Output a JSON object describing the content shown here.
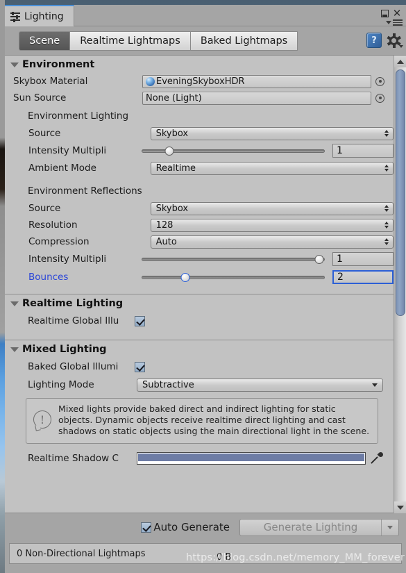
{
  "window": {
    "tab_title": "Lighting",
    "tab_icon": "sliders-icon",
    "minimize_label": "",
    "close_label": "✕",
    "panel_menu_icon": "panel-menu-icon"
  },
  "toolbar": {
    "tabs": [
      {
        "label": "Scene",
        "active": true
      },
      {
        "label": "Realtime Lightmaps",
        "active": false
      },
      {
        "label": "Baked Lightmaps",
        "active": false
      }
    ],
    "help_icon": "?",
    "gear_icon": "gear-icon"
  },
  "sections": {
    "environment": {
      "title": "Environment",
      "skybox_material": {
        "label": "Skybox Material",
        "value": "EveningSkyboxHDR",
        "icon": "material-sphere-icon"
      },
      "sun_source": {
        "label": "Sun Source",
        "value": "None (Light)"
      },
      "environment_lighting": {
        "title": "Environment Lighting",
        "source": {
          "label": "Source",
          "value": "Skybox"
        },
        "intensity_multiplier": {
          "label": "Intensity Multipli",
          "value": "1",
          "slider_pct": 15
        },
        "ambient_mode": {
          "label": "Ambient Mode",
          "value": "Realtime"
        }
      },
      "environment_reflections": {
        "title": "Environment Reflections",
        "source": {
          "label": "Source",
          "value": "Skybox"
        },
        "resolution": {
          "label": "Resolution",
          "value": "128"
        },
        "compression": {
          "label": "Compression",
          "value": "Auto"
        },
        "intensity_multiplier": {
          "label": "Intensity Multipli",
          "value": "1",
          "slider_pct": 97
        },
        "bounces": {
          "label": "Bounces",
          "value": "2",
          "slider_pct": 24,
          "focused": true
        }
      }
    },
    "realtime_lighting": {
      "title": "Realtime Lighting",
      "realtime_gi": {
        "label": "Realtime Global Illu",
        "checked": true
      }
    },
    "mixed_lighting": {
      "title": "Mixed Lighting",
      "baked_gi": {
        "label": "Baked Global Illumi",
        "checked": true
      },
      "lighting_mode": {
        "label": "Lighting Mode",
        "value": "Subtractive"
      },
      "info": "Mixed lights provide baked direct and indirect lighting for static objects. Dynamic objects receive realtime direct lighting and cast shadows on static objects using the main directional light in the scene.",
      "realtime_shadow_color": {
        "label": "Realtime Shadow C",
        "color": "#6d7ca5"
      }
    }
  },
  "footer": {
    "auto_generate": {
      "label": "Auto Generate",
      "checked": true
    },
    "generate_button": {
      "label": "Generate Lighting",
      "enabled": false
    }
  },
  "status": {
    "lightmaps": "0 Non-Directional Lightmaps",
    "size": "0 B"
  },
  "watermark": "https://blog.csdn.net/memory_MM_forever"
}
